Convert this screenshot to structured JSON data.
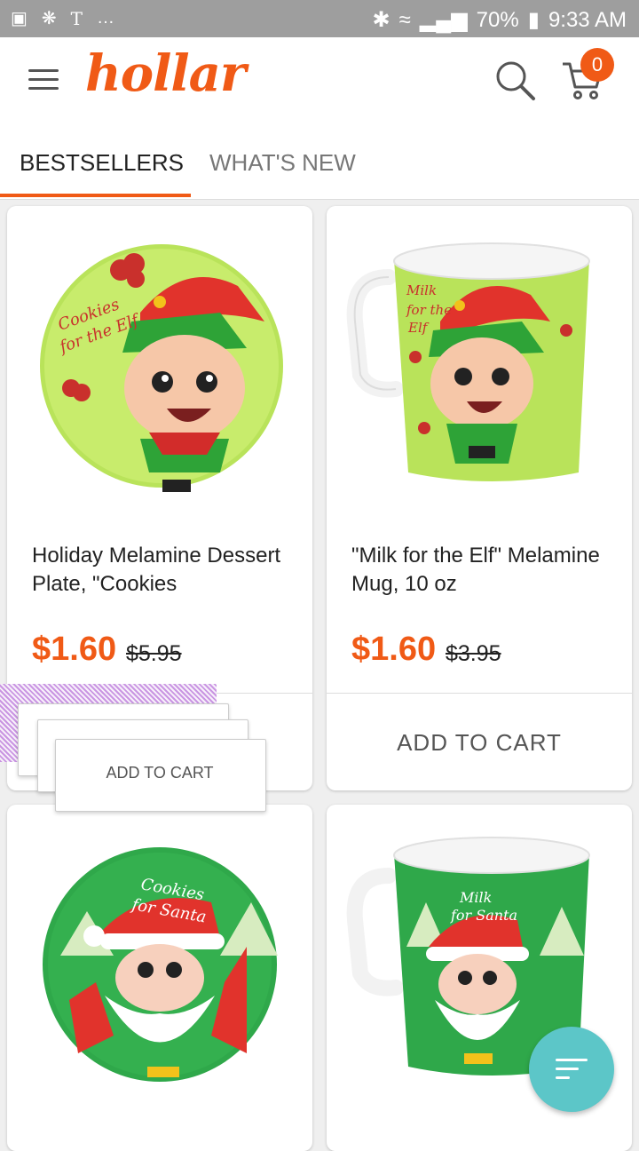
{
  "status_bar": {
    "battery": "70%",
    "time": "9:33 AM"
  },
  "header": {
    "logo": "hollar",
    "cart_count": "0"
  },
  "tabs": [
    {
      "label": "BESTSELLERS",
      "active": true
    },
    {
      "label": "WHAT'S NEW",
      "active": false
    }
  ],
  "products": [
    {
      "title": "Holiday Melamine Dessert Plate, \"Cookies",
      "price": "$1.60",
      "old_price": "$5.95",
      "button": "ADD TO CART",
      "image": "elf-plate"
    },
    {
      "title": "\"Milk for the Elf\" Melamine Mug, 10 oz",
      "price": "$1.60",
      "old_price": "$3.95",
      "button": "ADD TO CART",
      "image": "elf-mug"
    },
    {
      "title": "",
      "price": "",
      "old_price": "",
      "button": "",
      "image": "santa-plate"
    },
    {
      "title": "",
      "price": "",
      "old_price": "",
      "button": "",
      "image": "santa-mug"
    }
  ],
  "overlay": {
    "add_to_cart_label": "ADD TO CART"
  },
  "icons": {
    "menu": "hamburger-icon",
    "search": "search-icon",
    "cart": "cart-icon",
    "fab": "filter-icon"
  },
  "colors": {
    "brand": "#f05a16",
    "fab": "#5cc6c8"
  }
}
